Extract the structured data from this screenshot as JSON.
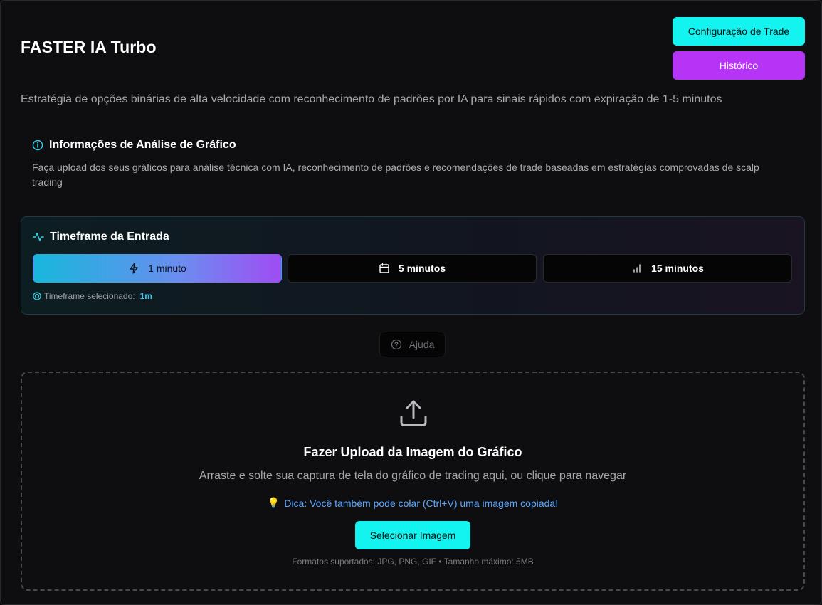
{
  "header": {
    "title": "FASTER IA Turbo",
    "config_button": "Configuração de Trade",
    "history_button": "Histórico",
    "subtitle": "Estratégia de opções binárias de alta velocidade com reconhecimento de padrões por IA para sinais rápidos com expiração de 1-5 minutos"
  },
  "info": {
    "icon": "info-icon",
    "title": "Informações de Análise de Gráfico",
    "text": "Faça upload dos seus gráficos para análise técnica com IA, reconhecimento de padrões e recomendações de trade baseadas em estratégias comprovadas de scalp trading"
  },
  "timeframe": {
    "icon": "activity-icon",
    "title": "Timeframe da Entrada",
    "options": [
      {
        "label": "1 minuto",
        "icon": "lightning-icon",
        "selected": true
      },
      {
        "label": "5 minutos",
        "icon": "calendar-icon",
        "selected": false
      },
      {
        "label": "15 minutos",
        "icon": "bar-chart-icon",
        "selected": false
      }
    ],
    "selected_label": "Timeframe selecionado:",
    "selected_value": "1m"
  },
  "help": {
    "label": "Ajuda",
    "icon": "help-circle-icon"
  },
  "upload": {
    "icon": "upload-icon",
    "title": "Fazer Upload da Imagem do Gráfico",
    "text": "Arraste e solte sua captura de tela do gráfico de trading aqui, ou clique para navegar",
    "tip_icon": "💡",
    "tip": "Dica: Você também pode colar (Ctrl+V) uma imagem copiada!",
    "button": "Selecionar Imagem",
    "formats": "Formatos suportados: JPG, PNG, GIF • Tamanho máximo: 5MB"
  },
  "colors": {
    "accent_cyan": "#13f3f0",
    "accent_purple": "#b534f5",
    "background": "#0e0e10",
    "tip_blue": "#5aa8ff"
  }
}
